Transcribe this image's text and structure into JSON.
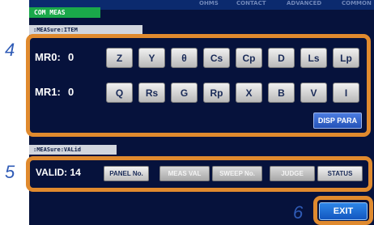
{
  "header": {
    "title": "COM MEAS"
  },
  "top_menu": [
    "OHMS",
    "CONTACT",
    "ADVANCED",
    "COMMON"
  ],
  "measure_item": {
    "section_label": ":MEASure:ITEM",
    "mr0": {
      "label": "MR0:",
      "value": "0",
      "params": [
        "Z",
        "Y",
        "θ",
        "Cs",
        "Cp",
        "D",
        "Ls",
        "Lp"
      ]
    },
    "mr1": {
      "label": "MR1:",
      "value": "0",
      "params": [
        "Q",
        "Rs",
        "G",
        "Rp",
        "X",
        "B",
        "V",
        "I"
      ]
    },
    "disp_para_label": "DISP PARA"
  },
  "measure_valid": {
    "section_label": ":MEASure:VALid",
    "label": "VALID:",
    "value": "14",
    "options": [
      {
        "label": "PANEL No.",
        "active": true
      },
      {
        "label": "MEAS VAL",
        "active": false
      },
      {
        "label": "SWEEP No.",
        "active": false
      },
      {
        "label": "JUDGE",
        "active": false
      },
      {
        "label": "STATUS",
        "active": true
      }
    ]
  },
  "exit_label": "EXIT",
  "callouts": {
    "item": "4",
    "valid": "5",
    "exit": "6"
  },
  "colors": {
    "highlight": "#e08a2e",
    "callout": "#2f5bb6",
    "screen_bg": "#06123c",
    "title_green": "#1aa84a"
  }
}
